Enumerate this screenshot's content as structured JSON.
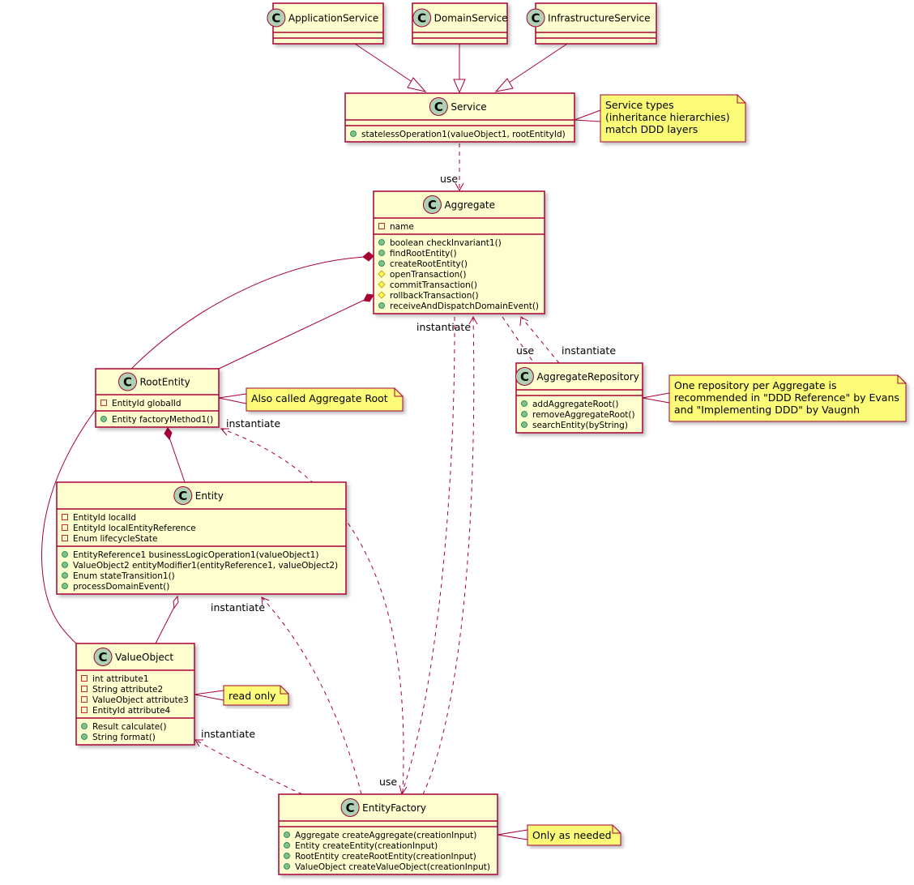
{
  "colors": {
    "class_fill": "#FEFECE",
    "border": "#A80036",
    "note_fill": "#FBFB77",
    "class_badge": "#ADD1B2",
    "public": "#84BE84",
    "protected": "#FFFF44",
    "private": "#C82930"
  },
  "classes": [
    {
      "name": "ApplicationService",
      "fields": [],
      "methods": []
    },
    {
      "name": "DomainService",
      "fields": [],
      "methods": []
    },
    {
      "name": "InfrastructureService",
      "fields": [],
      "methods": []
    },
    {
      "name": "Service",
      "fields": [],
      "methods": [
        {
          "vis": "+",
          "text": "statelessOperation1(valueObject1, rootEntityId)"
        }
      ]
    },
    {
      "name": "Aggregate",
      "fields": [
        {
          "vis": "-",
          "text": "name"
        }
      ],
      "methods": [
        {
          "vis": "+",
          "text": "boolean checkInvariant1()"
        },
        {
          "vis": "+",
          "text": "findRootEntity()"
        },
        {
          "vis": "+",
          "text": "createRootEntity()"
        },
        {
          "vis": "#",
          "text": "openTransaction()"
        },
        {
          "vis": "#",
          "text": "commitTransaction()"
        },
        {
          "vis": "#",
          "text": "rollbackTransaction()"
        },
        {
          "vis": "+",
          "text": "receiveAndDispatchDomainEvent()"
        }
      ]
    },
    {
      "name": "AggregateRepository",
      "fields": [],
      "methods": [
        {
          "vis": "+",
          "text": "addAggregateRoot()"
        },
        {
          "vis": "+",
          "text": "removeAggregateRoot()"
        },
        {
          "vis": "+",
          "text": "searchEntity(byString)"
        }
      ]
    },
    {
      "name": "RootEntity",
      "fields": [
        {
          "vis": "-",
          "text": "EntityId globalId"
        }
      ],
      "methods": [
        {
          "vis": "+",
          "text": "Entity factoryMethod1()"
        }
      ]
    },
    {
      "name": "Entity",
      "fields": [
        {
          "vis": "-",
          "text": "EntityId localId"
        },
        {
          "vis": "-",
          "text": "EntityId localEntityReference"
        },
        {
          "vis": "-",
          "text": "Enum lifecycleState"
        }
      ],
      "methods": [
        {
          "vis": "+",
          "text": "EntityReference1 businessLogicOperation1(valueObject1)"
        },
        {
          "vis": "+",
          "text": "ValueObject2 entityModifier1(entityReference1, valueObject2)"
        },
        {
          "vis": "+",
          "text": "Enum stateTransition1()"
        },
        {
          "vis": "+",
          "text": "processDomainEvent()"
        }
      ]
    },
    {
      "name": "ValueObject",
      "fields": [
        {
          "vis": "-",
          "text": "int attribute1"
        },
        {
          "vis": "-",
          "text": "String attribute2"
        },
        {
          "vis": "-",
          "text": "ValueObject attribute3"
        },
        {
          "vis": "-",
          "text": "EntityId attribute4"
        }
      ],
      "methods": [
        {
          "vis": "+",
          "text": "Result calculate()"
        },
        {
          "vis": "+",
          "text": "String format()"
        }
      ]
    },
    {
      "name": "EntityFactory",
      "fields": [],
      "methods": [
        {
          "vis": "+",
          "text": "Aggregate createAggregate(creationInput)"
        },
        {
          "vis": "+",
          "text": "Entity createEntity(creationInput)"
        },
        {
          "vis": "+",
          "text": "RootEntity createRootEntity(creationInput)"
        },
        {
          "vis": "+",
          "text": "ValueObject createValueObject(creationInput)"
        }
      ]
    }
  ],
  "class_badge_letter": "C",
  "notes": [
    {
      "lines": [
        "Service types",
        "(inheritance hierarchies)",
        "match DDD layers"
      ]
    },
    {
      "lines": [
        "One repository per Aggregate is",
        "recommended in \"DDD Reference\" by Evans",
        "and \"Implementing DDD\" by Vaugnh"
      ]
    },
    {
      "lines": [
        "Also called Aggregate Root"
      ]
    },
    {
      "lines": [
        "read only"
      ]
    },
    {
      "lines": [
        "Only as needed"
      ]
    }
  ],
  "edge_labels": {
    "service_use": "use",
    "repo_use": "use",
    "repo_instantiate": "instantiate",
    "factory_aggregate_instantiate": "instantiate",
    "factory_use": "use",
    "factory_rootentity_instantiate": "instantiate",
    "factory_entity_instantiate": "instantiate",
    "factory_valueobject_instantiate": "instantiate"
  }
}
